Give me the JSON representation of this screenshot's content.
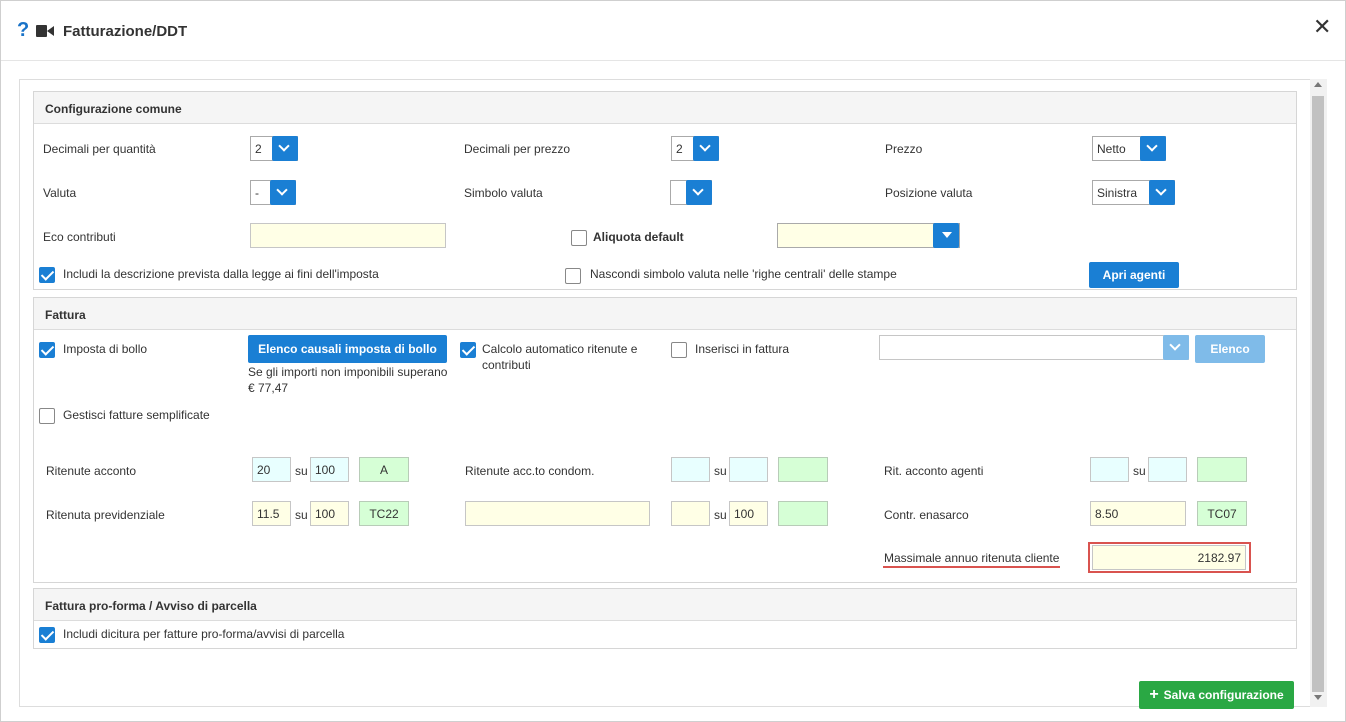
{
  "dialog": {
    "title": "Fatturazione/DDT",
    "help_icon": "question-icon",
    "video_icon": "video-camera-icon",
    "close_icon": "close-icon"
  },
  "configurazione": {
    "heading": "Configurazione comune",
    "decimali_quantita": {
      "label": "Decimali per quantità",
      "value": "2"
    },
    "decimali_prezzo": {
      "label": "Decimali per prezzo",
      "value": "2"
    },
    "prezzo": {
      "label": "Prezzo",
      "value": "Netto"
    },
    "valuta": {
      "label": "Valuta",
      "value": "-"
    },
    "simbolo_valuta": {
      "label": "Simbolo valuta",
      "value": ""
    },
    "posizione_valuta": {
      "label": "Posizione valuta",
      "value": "Sinistra"
    },
    "eco_contributi": {
      "label": "Eco contributi",
      "value": ""
    },
    "aliquota_default": {
      "label": "Aliquota default",
      "checked": false,
      "value": ""
    },
    "includi_descrizione": {
      "label": "Includi la descrizione prevista dalla legge ai fini dell'imposta",
      "checked": true
    },
    "nascondi_simbolo": {
      "label": "Nascondi simbolo valuta nelle 'righe centrali' delle stampe",
      "checked": false
    },
    "apri_agenti": "Apri agenti"
  },
  "fattura": {
    "heading": "Fattura",
    "imposta_bollo": {
      "label": "Imposta di bollo",
      "checked": true
    },
    "elenco_causali": "Elenco causali imposta di bollo",
    "note_line1": "Se gli importi non imponibili superano",
    "note_line2": "€ 77,47",
    "calcolo_automatico_line1": "Calcolo automatico ritenute e",
    "calcolo_automatico_line2": "contributi",
    "calcolo_automatico_checked": true,
    "inserisci_fattura": {
      "label": "Inserisci in fattura",
      "checked": false
    },
    "elenco_select_value": "",
    "elenco_button": "Elenco",
    "gestisci_semplificate": {
      "label": "Gestisci fatture semplificate",
      "checked": false
    },
    "su_label": "su",
    "ritenute_acconto": {
      "label": "Ritenute acconto",
      "perc": "20",
      "base": "100",
      "code": "A"
    },
    "ritenute_condom": {
      "label": "Ritenute acc.to condom.",
      "perc": "",
      "base": "",
      "code": ""
    },
    "rit_agenti": {
      "label": "Rit. acconto agenti",
      "perc": "",
      "base": "",
      "code": ""
    },
    "ritenuta_previdenziale": {
      "label": "Ritenuta previdenziale",
      "perc": "11.5",
      "base": "100",
      "code": "TC22"
    },
    "extra_row": {
      "text": "",
      "perc": "",
      "base": "100",
      "code": ""
    },
    "contr_enasarco": {
      "label": "Contr. enasarco",
      "value": "8.50",
      "code": "TC07"
    },
    "massimale": {
      "label": "Massimale annuo ritenuta cliente",
      "value": "2182.97"
    }
  },
  "proforma": {
    "heading": "Fattura pro-forma / Avviso di parcella",
    "includi_dicitura": {
      "label": "Includi dicitura per fatture pro-forma/avvisi di parcella",
      "checked": true
    }
  },
  "footer": {
    "save_label": "Salva configurazione",
    "save_icon": "plus-icon"
  },
  "colors": {
    "primary": "#1a7fd4",
    "success": "#2aa844",
    "highlight": "#d9534f"
  }
}
